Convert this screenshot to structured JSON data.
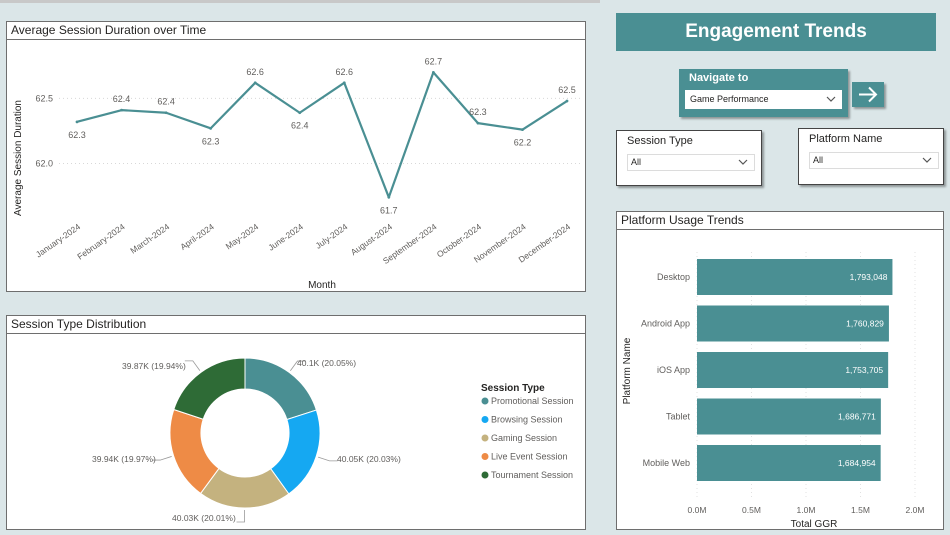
{
  "colors": {
    "accent": "#4a8f93",
    "line": "#4a8f93",
    "promotional": "#4a8f93",
    "browsing": "#15a8f2",
    "gaming": "#c4b27f",
    "live_event": "#ee8b46",
    "tournament": "#2e6b36"
  },
  "banner": {
    "title": "Engagement Trends"
  },
  "navigation": {
    "label": "Navigate to",
    "selected": "Game Performance",
    "go_icon": "arrow-right-icon"
  },
  "slicers": {
    "session_type": {
      "label": "Session Type",
      "value": "All"
    },
    "platform_name": {
      "label": "Platform Name",
      "value": "All"
    }
  },
  "line_chart": {
    "title": "Average Session Duration over Time",
    "xlabel": "Month",
    "ylabel": "Average Session Duration",
    "y_ticks": [
      "62.5",
      "62.0"
    ]
  },
  "donut_chart": {
    "title": "Session Type Distribution",
    "legend_title": "Session Type"
  },
  "bar_chart": {
    "title": "Platform Usage Trends",
    "xlabel": "Total GGR",
    "ylabel": "Platform Name",
    "x_ticks": [
      "0.0M",
      "0.5M",
      "1.0M",
      "1.5M",
      "2.0M"
    ]
  },
  "chart_data": [
    {
      "type": "line",
      "title": "Average Session Duration over Time",
      "xlabel": "Month",
      "ylabel": "Average Session Duration",
      "categories": [
        "January-2024",
        "February-2024",
        "March-2024",
        "April-2024",
        "May-2024",
        "June-2024",
        "July-2024",
        "August-2024",
        "September-2024",
        "October-2024",
        "November-2024",
        "December-2024"
      ],
      "values": [
        62.3,
        62.4,
        62.4,
        62.3,
        62.6,
        62.4,
        62.6,
        61.7,
        62.7,
        62.3,
        62.2,
        62.5
      ],
      "precise_values": [
        62.32,
        62.41,
        62.39,
        62.27,
        62.62,
        62.39,
        62.62,
        61.74,
        62.7,
        62.31,
        62.26,
        62.48
      ],
      "data_labels": [
        "62.3",
        "62.4",
        "62.4",
        "62.3",
        "62.6",
        "62.4",
        "62.6",
        "61.7",
        "62.7",
        "62.3",
        "62.2",
        "62.5"
      ],
      "label_positions": [
        "below",
        "above",
        "above",
        "below",
        "above",
        "below",
        "above",
        "below",
        "above",
        "above",
        "below",
        "above"
      ],
      "y_ticks": [
        62.5,
        62.0
      ],
      "ylim": [
        61.65,
        62.78
      ],
      "grid": true
    },
    {
      "type": "pie",
      "title": "Session Type Distribution",
      "legend_title": "Session Type",
      "legend_position": "right",
      "slices": [
        {
          "name": "Promotional Session",
          "value": 40.1,
          "label": "40.1K (20.05%)",
          "color": "#4a8f93"
        },
        {
          "name": "Browsing Session",
          "value": 40.05,
          "label": "40.05K (20.03%)",
          "color": "#15a8f2"
        },
        {
          "name": "Gaming Session",
          "value": 40.03,
          "label": "40.03K (20.01%)",
          "color": "#c4b27f"
        },
        {
          "name": "Live Event Session",
          "value": 39.94,
          "label": "39.94K (19.97%)",
          "color": "#ee8b46"
        },
        {
          "name": "Tournament Session",
          "value": 39.87,
          "label": "39.87K (19.94%)",
          "color": "#2e6b36"
        }
      ]
    },
    {
      "type": "bar",
      "orientation": "horizontal",
      "title": "Platform Usage Trends",
      "xlabel": "Total GGR",
      "ylabel": "Platform Name",
      "categories": [
        "Desktop",
        "Android App",
        "iOS App",
        "Tablet",
        "Mobile Web"
      ],
      "values": [
        1793048,
        1760829,
        1753705,
        1686771,
        1684954
      ],
      "data_labels": [
        "1,793,048",
        "1,760,829",
        "1,753,705",
        "1,686,771",
        "1,684,954"
      ],
      "x_ticks": [
        "0.0M",
        "0.5M",
        "1.0M",
        "1.5M",
        "2.0M"
      ],
      "xlim": [
        0,
        2000000
      ],
      "grid": true
    }
  ]
}
